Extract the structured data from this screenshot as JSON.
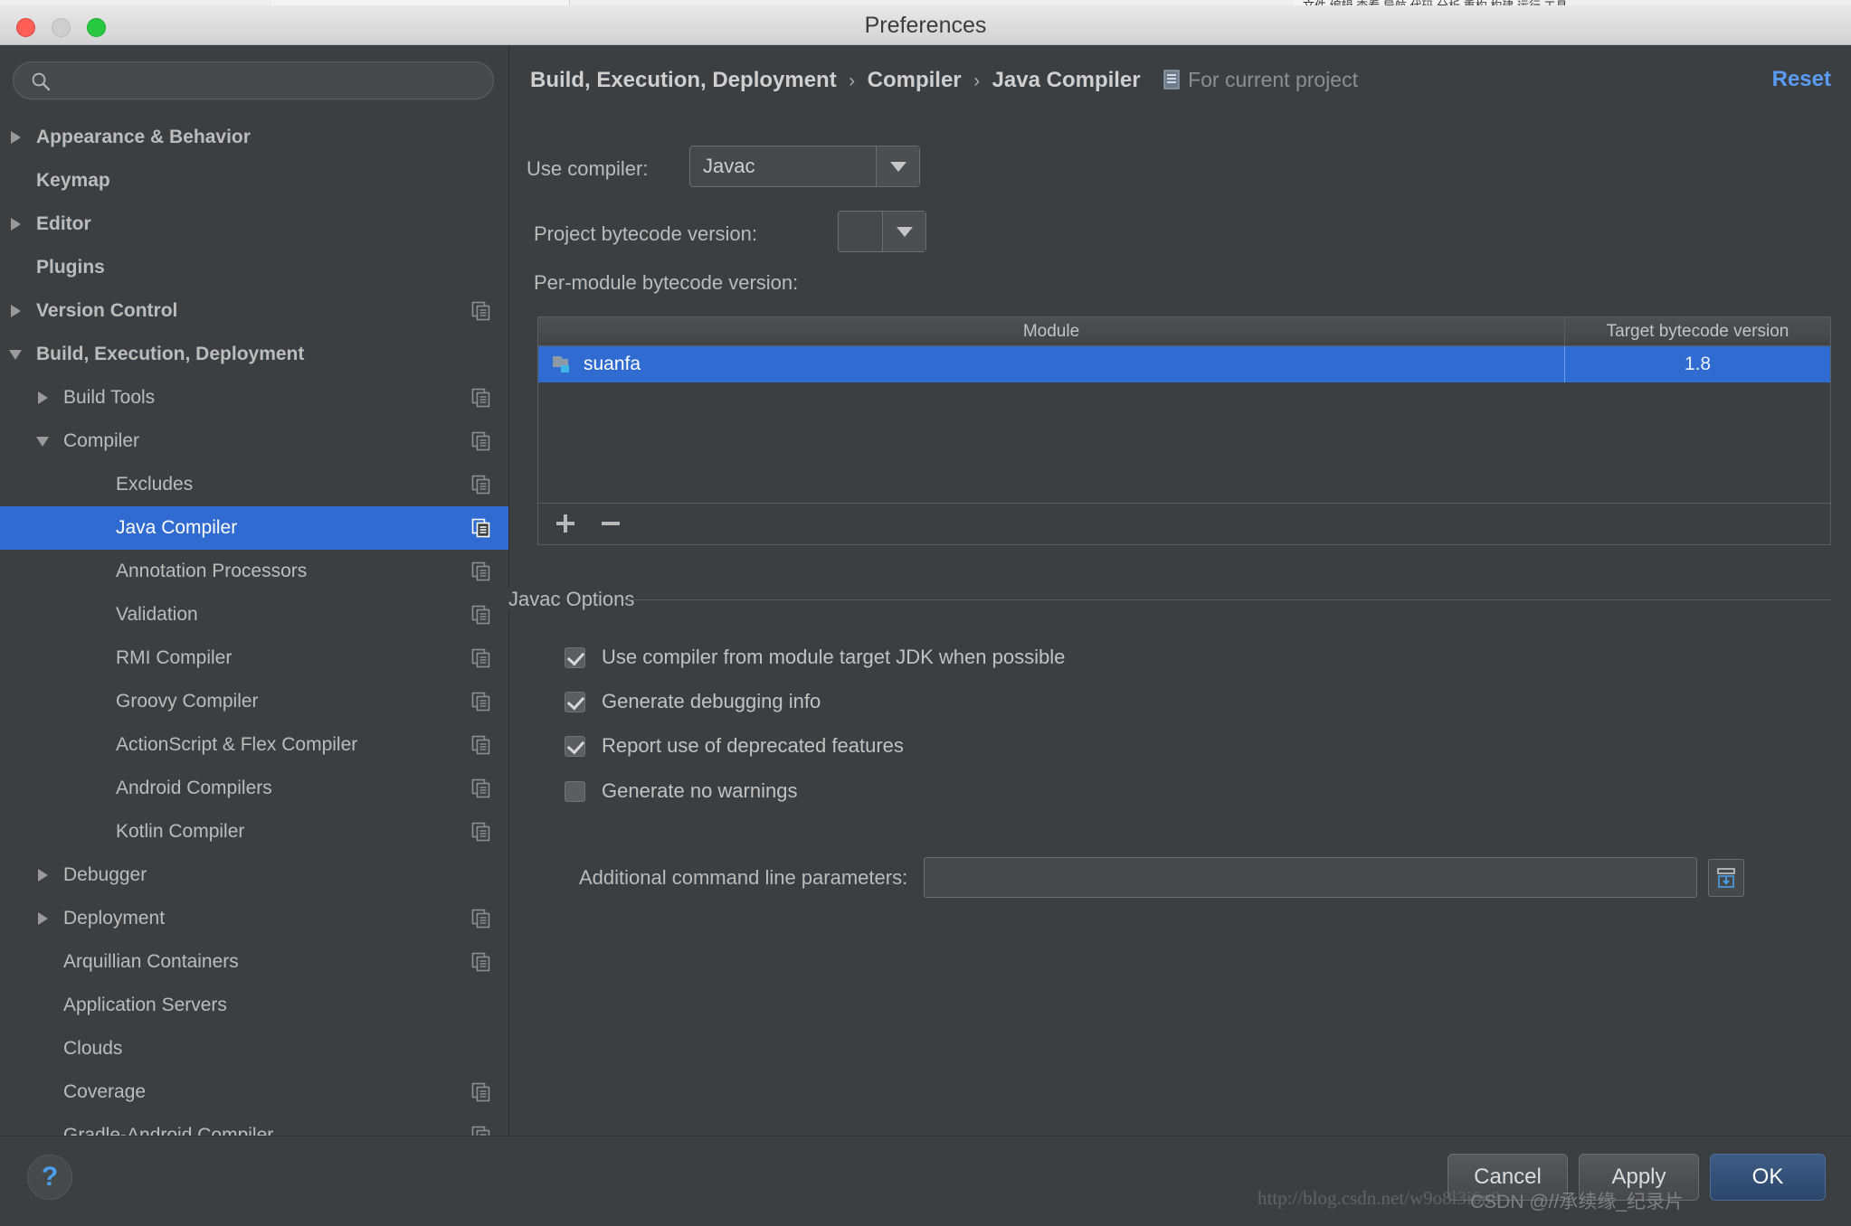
{
  "window": {
    "title": "Preferences",
    "traffic": [
      "close",
      "minimize",
      "maximize"
    ],
    "behind_text": "文件 编辑 查看 导航 代码 分析 重构 构建 运行 工具"
  },
  "search": {
    "value": "",
    "placeholder": "",
    "icon": "search-icon"
  },
  "sidebar": {
    "items": [
      {
        "label": "Appearance & Behavior",
        "depth": 0,
        "arrow": "right",
        "bold": true,
        "copy": false,
        "selected": false
      },
      {
        "label": "Keymap",
        "depth": 0,
        "arrow": "none",
        "bold": true,
        "copy": false,
        "selected": false
      },
      {
        "label": "Editor",
        "depth": 0,
        "arrow": "right",
        "bold": true,
        "copy": false,
        "selected": false
      },
      {
        "label": "Plugins",
        "depth": 0,
        "arrow": "none",
        "bold": true,
        "copy": false,
        "selected": false
      },
      {
        "label": "Version Control",
        "depth": 0,
        "arrow": "right",
        "bold": true,
        "copy": true,
        "selected": false
      },
      {
        "label": "Build, Execution, Deployment",
        "depth": 0,
        "arrow": "down",
        "bold": true,
        "copy": false,
        "selected": false
      },
      {
        "label": "Build Tools",
        "depth": 1,
        "arrow": "right",
        "bold": false,
        "copy": true,
        "selected": false
      },
      {
        "label": "Compiler",
        "depth": 1,
        "arrow": "down",
        "bold": false,
        "copy": true,
        "selected": false
      },
      {
        "label": "Excludes",
        "depth": 2,
        "arrow": "none",
        "bold": false,
        "copy": true,
        "selected": false
      },
      {
        "label": "Java Compiler",
        "depth": 2,
        "arrow": "none",
        "bold": false,
        "copy": true,
        "selected": true
      },
      {
        "label": "Annotation Processors",
        "depth": 2,
        "arrow": "none",
        "bold": false,
        "copy": true,
        "selected": false
      },
      {
        "label": "Validation",
        "depth": 2,
        "arrow": "none",
        "bold": false,
        "copy": true,
        "selected": false
      },
      {
        "label": "RMI Compiler",
        "depth": 2,
        "arrow": "none",
        "bold": false,
        "copy": true,
        "selected": false
      },
      {
        "label": "Groovy Compiler",
        "depth": 2,
        "arrow": "none",
        "bold": false,
        "copy": true,
        "selected": false
      },
      {
        "label": "ActionScript & Flex Compiler",
        "depth": 2,
        "arrow": "none",
        "bold": false,
        "copy": true,
        "selected": false
      },
      {
        "label": "Android Compilers",
        "depth": 2,
        "arrow": "none",
        "bold": false,
        "copy": true,
        "selected": false
      },
      {
        "label": "Kotlin Compiler",
        "depth": 2,
        "arrow": "none",
        "bold": false,
        "copy": true,
        "selected": false
      },
      {
        "label": "Debugger",
        "depth": 1,
        "arrow": "right",
        "bold": false,
        "copy": false,
        "selected": false
      },
      {
        "label": "Deployment",
        "depth": 1,
        "arrow": "right",
        "bold": false,
        "copy": true,
        "selected": false
      },
      {
        "label": "Arquillian Containers",
        "depth": 1,
        "arrow": "none",
        "bold": false,
        "copy": true,
        "selected": false
      },
      {
        "label": "Application Servers",
        "depth": 1,
        "arrow": "none",
        "bold": false,
        "copy": false,
        "selected": false
      },
      {
        "label": "Clouds",
        "depth": 1,
        "arrow": "none",
        "bold": false,
        "copy": false,
        "selected": false
      },
      {
        "label": "Coverage",
        "depth": 1,
        "arrow": "none",
        "bold": false,
        "copy": true,
        "selected": false
      },
      {
        "label": "Gradle-Android Compiler",
        "depth": 1,
        "arrow": "none",
        "bold": false,
        "copy": true,
        "selected": false
      }
    ]
  },
  "header": {
    "crumb1": "Build, Execution, Deployment",
    "crumb2": "Compiler",
    "crumb3": "Java Compiler",
    "separator": "›",
    "scope_label": "For current project",
    "scope_icon": "project-scope-icon",
    "reset_label": "Reset"
  },
  "form": {
    "use_compiler_label": "Use compiler:",
    "use_compiler_value": "Javac",
    "project_bytecode_label": "Project bytecode version:",
    "project_bytecode_value": "",
    "per_module_label": "Per-module bytecode version:"
  },
  "table": {
    "columns": [
      "Module",
      "Target bytecode version"
    ],
    "rows": [
      {
        "module": "suanfa",
        "target": "1.8",
        "selected": true,
        "icon": "module-icon"
      }
    ],
    "toolbar": {
      "add": "+",
      "remove": "−"
    }
  },
  "javac": {
    "group_title": "Javac Options",
    "options": [
      {
        "label": "Use compiler from module target JDK when possible",
        "checked": true
      },
      {
        "label": "Generate debugging info",
        "checked": true
      },
      {
        "label": "Report use of deprecated features",
        "checked": true
      },
      {
        "label": "Generate no warnings",
        "checked": false
      }
    ],
    "params_label": "Additional command line parameters:",
    "params_value": "",
    "params_placeholder": "",
    "expand_icon": "expand-insert-icon"
  },
  "footer": {
    "help": "?",
    "cancel": "Cancel",
    "apply": "Apply",
    "ok": "OK"
  },
  "watermark": {
    "url": "http://blog.csdn.net/w9o8l3i6n8",
    "credit": "CSDN @//承续缘_纪录片"
  },
  "colors": {
    "accent": "#2f6bd0",
    "link": "#5a9cf5",
    "bg": "#3c3f41",
    "text": "#bcbcbc"
  }
}
